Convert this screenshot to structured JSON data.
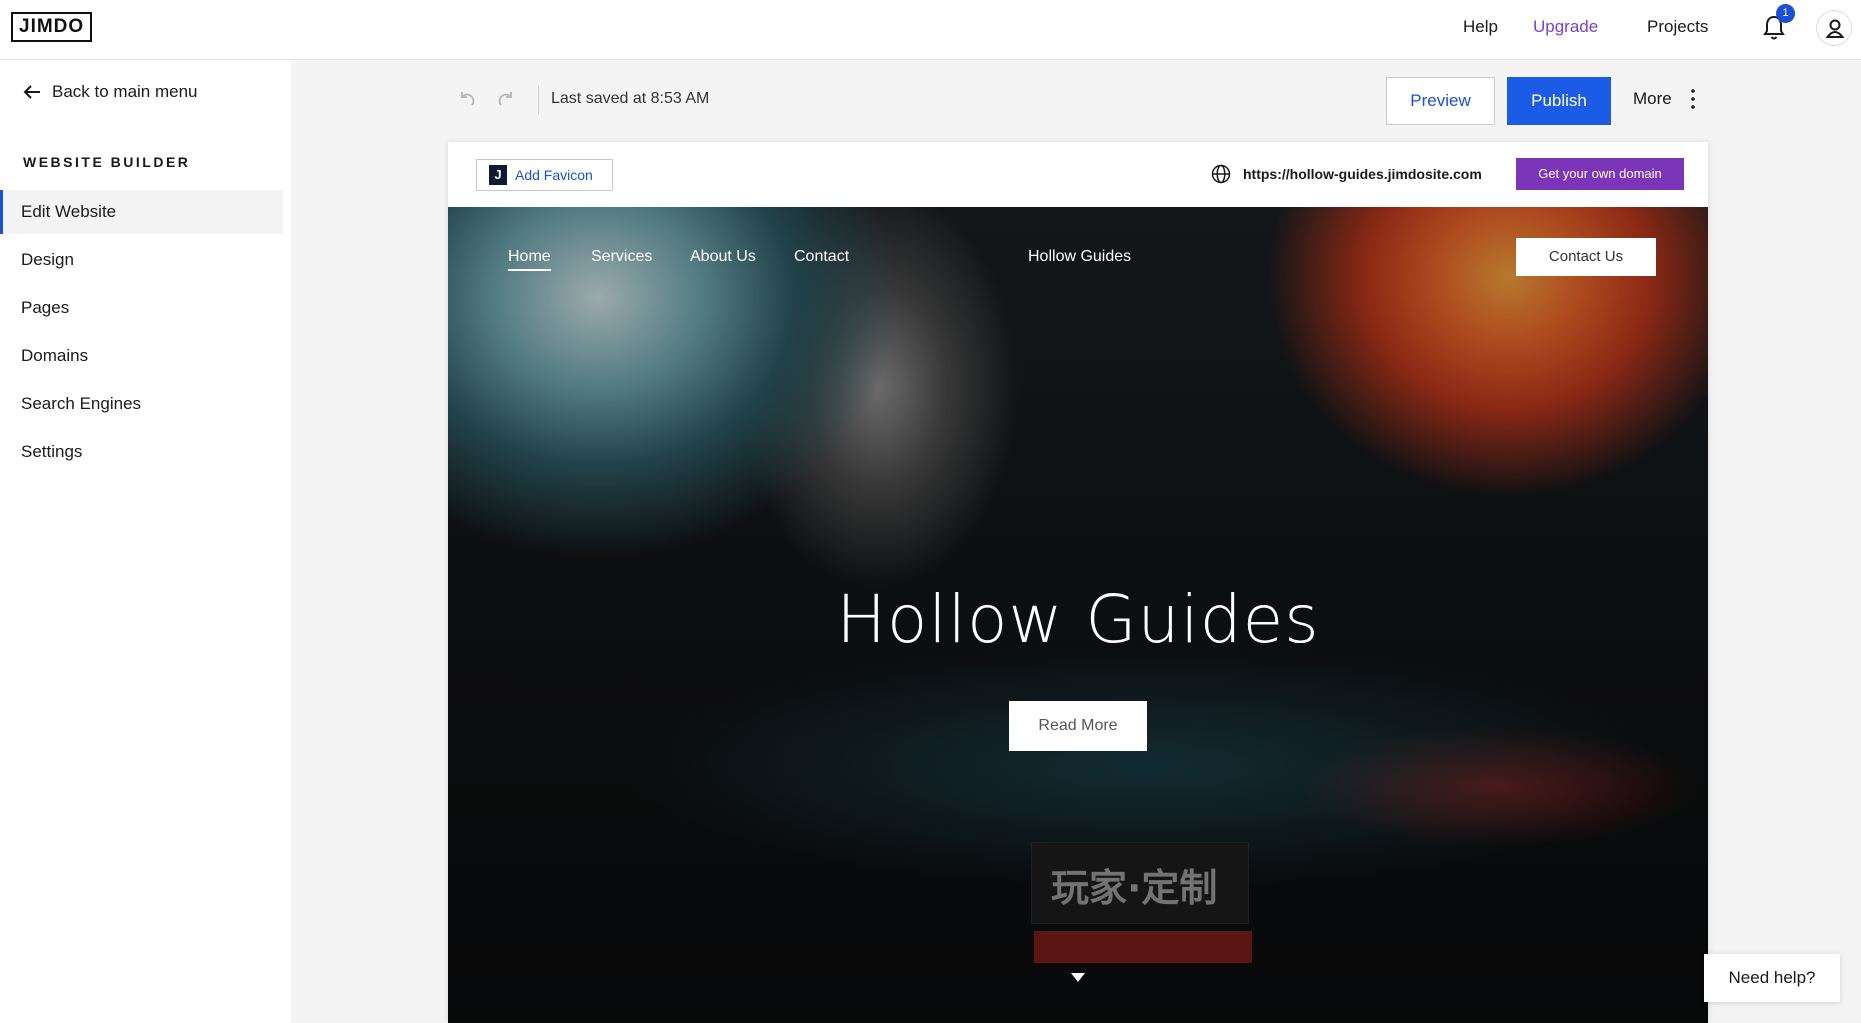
{
  "topbar": {
    "logo": "JIMDO",
    "help": "Help",
    "upgrade": "Upgrade",
    "projects": "Projects",
    "notifications_count": "1"
  },
  "sidebar": {
    "back": "Back to main menu",
    "section_title": "WEBSITE BUILDER",
    "items": [
      {
        "label": "Edit Website",
        "active": true
      },
      {
        "label": "Design"
      },
      {
        "label": "Pages"
      },
      {
        "label": "Domains"
      },
      {
        "label": "Search Engines"
      },
      {
        "label": "Settings"
      }
    ]
  },
  "toolbar": {
    "saved_status": "Last saved at 8:53 AM",
    "preview_label": "Preview",
    "publish_label": "Publish",
    "more_label": "More"
  },
  "frame": {
    "favicon_label": "Add Favicon",
    "favicon_letter": "J",
    "url": "https://hollow-guides.jimdosite.com",
    "domain_button": "Get your own domain"
  },
  "site": {
    "nav": [
      "Home",
      "Services",
      "About Us",
      "Contact"
    ],
    "brand": "Hollow Guides",
    "contact_button": "Contact Us",
    "hero_title": "Hollow Guides",
    "hero_button": "Read More",
    "stamp_text": "玩家·定制"
  },
  "help_widget": "Need help?",
  "colors": {
    "accent": "#1b5be6",
    "upgrade": "#7a3fd1",
    "domain_button": "#7b35b8"
  }
}
